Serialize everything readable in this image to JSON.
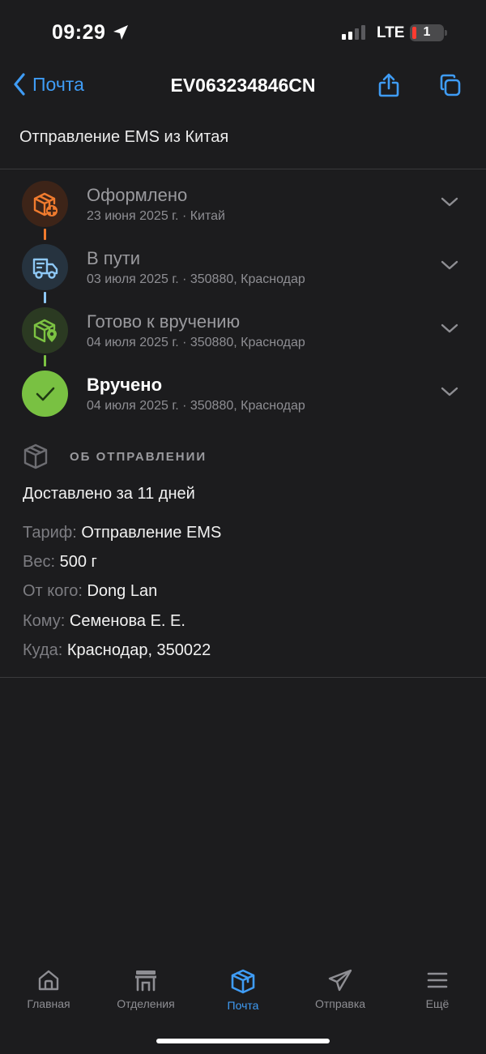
{
  "status_bar": {
    "time": "09:29",
    "network": "LTE",
    "battery": "1"
  },
  "nav": {
    "back_label": "Почта",
    "title": "EV063234846CN"
  },
  "subtitle": "Отправление EMS из Китая",
  "timeline": [
    {
      "title": "Оформлено",
      "meta": "23 июня 2025 г. · Китай",
      "icon": "box-plus-icon",
      "color": "#f07b2e"
    },
    {
      "title": "В пути",
      "meta": "03 июля 2025 г. · 350880, Краснодар",
      "icon": "truck-icon",
      "color": "#8ec8f5"
    },
    {
      "title": "Готово к вручению",
      "meta": "04 июля 2025 г. · 350880, Краснодар",
      "icon": "box-pin-icon",
      "color": "#7cc242"
    },
    {
      "title": "Вручено",
      "meta": "04 июля 2025 г. · 350880, Краснодар",
      "icon": "check-icon",
      "color": "#79c142"
    }
  ],
  "about": {
    "label": "ОБ ОТПРАВЛЕНИИ",
    "delivered": "Доставлено за 11 дней",
    "details": [
      {
        "key": "Тариф:",
        "value": "Отправление EMS"
      },
      {
        "key": "Вес:",
        "value": "500 г"
      },
      {
        "key": "От кого:",
        "value": "Dong Lan"
      },
      {
        "key": "Кому:",
        "value": "Семенова Е. Е."
      },
      {
        "key": "Куда:",
        "value": "Краснодар, 350022"
      }
    ]
  },
  "tabs": [
    {
      "label": "Главная",
      "icon": "home-icon"
    },
    {
      "label": "Отделения",
      "icon": "store-icon"
    },
    {
      "label": "Почта",
      "icon": "package-icon",
      "active": true
    },
    {
      "label": "Отправка",
      "icon": "paper-plane-icon"
    },
    {
      "label": "Ещё",
      "icon": "menu-icon"
    }
  ],
  "colors": {
    "accent": "#3f9cf5",
    "background": "#1c1c1e"
  }
}
